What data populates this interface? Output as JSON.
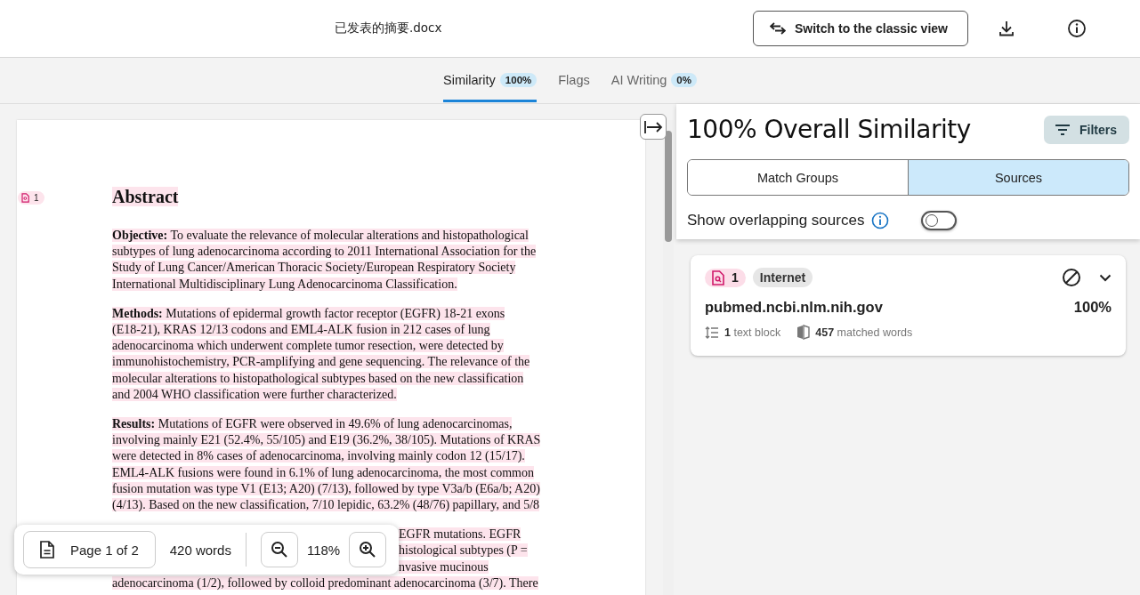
{
  "header": {
    "file_name": "已发表的摘要.docx",
    "switch_button": "Switch to the classic view"
  },
  "tabs": [
    {
      "label": "Similarity",
      "badge": "100%",
      "selected": true
    },
    {
      "label": "Flags",
      "selected": false
    },
    {
      "label": "AI Writing",
      "badge": "0%",
      "selected": false
    }
  ],
  "document": {
    "match_marker": "1",
    "heading": "Abstract",
    "paragraphs": [
      {
        "lines": [
          "**Objective:** To evaluate the relevance of molecular alterations and histopathological",
          "subtypes of lung adenocarcinoma according to 2011 International Association for the",
          "Study of Lung Cancer/American Thoracic Society/European Respiratory Society",
          "International Multidisciplinary Lung Adenocarcinoma Classification."
        ]
      },
      {
        "lines": [
          "**Methods:** Mutations of epidermal growth factor receptor (EGFR) 18-21 exons",
          "(E18-21), KRAS 12/13 codons and EML4-ALK fusion in 212 cases of lung",
          "adenocarcinoma which underwent complete tumor resection, were detected by",
          "immunohistochemistry, PCR-amplifying and gene sequencing. The relevance of the",
          "molecular alterations to histopathological subtypes based on the new classification",
          "and 2004 WHO classification were further characterized."
        ]
      },
      {
        "lines": [
          "**Results:** Mutations of EGFR were observed in 49.6% of lung adenocarcinomas,",
          "involving mainly E21 (52.4%, 55/105) and E19 (36.2%, 38/105). Mutations of KRAS",
          "were detected in 8% cases of adenocarcinoma, involving mainly codon 12 (15/17).",
          "EML4-ALK fusions were found in 6.1% of lung adenocarcinoma, the most common",
          "fusion mutation was type V1 (E13; A20) (7/13), followed by type V3a/b (E6a/b; A20)",
          "(4/13). Based on the new classification, 7/10 lepidic, 63.2% (48/76) papillary, and 5/8"
        ]
      }
    ],
    "partial_lines": [
      {
        "kind": "tail",
        "text": "EGFR mutations. EGFR"
      },
      {
        "kind": "tail",
        "text": "histological subtypes (P ="
      },
      {
        "kind": "tail",
        "text": "nvasive mucinous"
      },
      {
        "kind": "full",
        "text": "adenocarcinoma (1/2), followed by colloid predominant adenocarcinoma (3/7). There"
      }
    ]
  },
  "toolbar": {
    "page": "Page 1 of 2",
    "words": "420 words",
    "zoom": "118%"
  },
  "panel": {
    "title": "100% Overall Similarity",
    "filters_button": "Filters",
    "segments": [
      {
        "label": "Match Groups",
        "selected": false
      },
      {
        "label": "Sources",
        "selected": true
      }
    ],
    "overlap_toggle": {
      "label": "Show overlapping sources",
      "on": false
    },
    "sources": [
      {
        "number": "1",
        "type": "Internet",
        "title": "pubmed.ncbi.nlm.nih.gov",
        "percent": "100%",
        "text_blocks": "**1** text block",
        "matched_words": "**457** matched words"
      }
    ]
  }
}
